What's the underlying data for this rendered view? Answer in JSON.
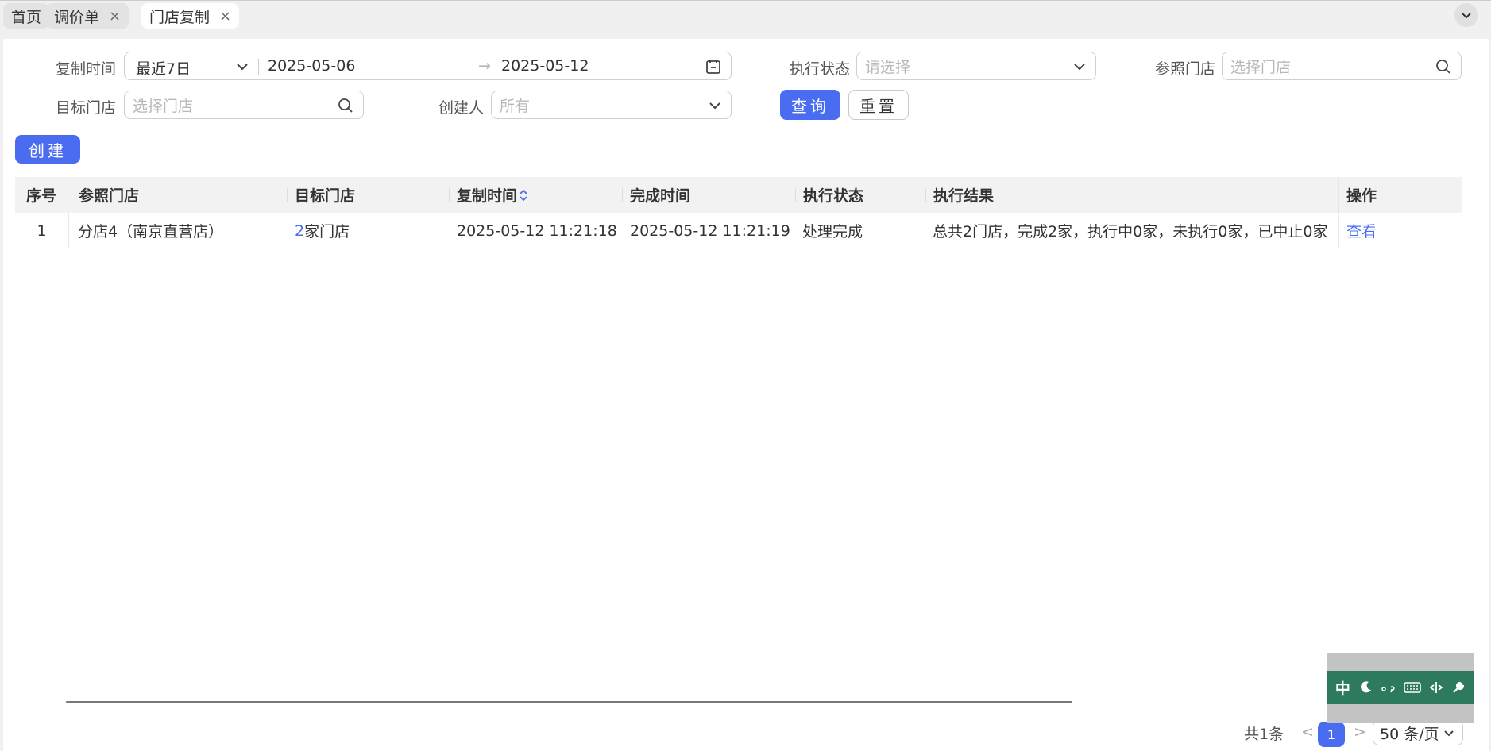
{
  "tabs": [
    {
      "label": "首页",
      "closable": false,
      "active": false
    },
    {
      "label": "调价单",
      "closable": true,
      "active": false
    },
    {
      "label": "门店复制",
      "closable": true,
      "active": true
    }
  ],
  "tab_close_glyph": "×",
  "filters": {
    "copy_time_label": "复制时间",
    "copy_time_range": "最近7日",
    "start_date": "2025-05-06",
    "range_sep": "→",
    "end_date": "2025-05-12",
    "exec_status_label": "执行状态",
    "exec_status_placeholder": "请选择",
    "ref_store_label": "参照门店",
    "ref_store_placeholder": "选择门店",
    "target_store_label": "目标门店",
    "target_store_placeholder": "选择门店",
    "creator_label": "创建人",
    "creator_placeholder": "所有",
    "query_button": "查询",
    "reset_button": "重置"
  },
  "create_button": "创建",
  "table": {
    "headers": {
      "seq": "序号",
      "ref_store": "参照门店",
      "target_store": "目标门店",
      "copy_time": "复制时间",
      "finish_time": "完成时间",
      "exec_status": "执行状态",
      "exec_result": "执行结果",
      "action": "操作"
    },
    "rows": [
      {
        "seq": "1",
        "ref_store": "分店4（南京直营店）",
        "target_count": "2",
        "target_suffix": "家门店",
        "copy_time": "2025-05-12 11:21:18",
        "finish_time": "2025-05-12 11:21:19",
        "exec_status": "处理完成",
        "exec_result": "总共2门店，完成2家，执行中0家，未执行0家，已中止0家",
        "action": "查看"
      }
    ]
  },
  "pagination": {
    "total": "共1条",
    "prev": "<",
    "current": "1",
    "next": ">",
    "page_size": "50 条/页"
  },
  "ime_toolbar": {
    "lang": "中"
  },
  "colors": {
    "primary": "#4a6cf0",
    "ime_green": "#2d7a5c"
  }
}
